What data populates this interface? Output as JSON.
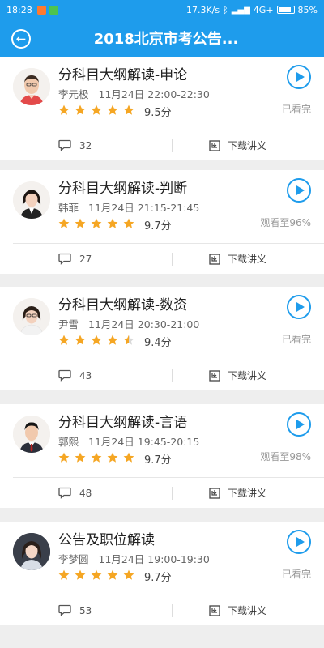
{
  "status_bar": {
    "time": "18:28",
    "network_speed": "17.3K/s",
    "network_type": "4G+",
    "battery": "85%",
    "battery_level": 0.85
  },
  "app_bar": {
    "title": "2018北京市考公告..."
  },
  "courses": [
    {
      "title": "分科目大纲解读-申论",
      "teacher": "李元极",
      "time": "11月24日 22:00-22:30",
      "rating": 5,
      "score": "9.5分",
      "progress": "已看完",
      "comments": "32",
      "download_label": "下载讲义"
    },
    {
      "title": "分科目大纲解读-判断",
      "teacher": "韩菲",
      "time": "11月24日 21:15-21:45",
      "rating": 5,
      "score": "9.7分",
      "progress": "观看至96%",
      "comments": "27",
      "download_label": "下载讲义"
    },
    {
      "title": "分科目大纲解读-数资",
      "teacher": "尹雪",
      "time": "11月24日 20:30-21:00",
      "rating": 4.5,
      "score": "9.4分",
      "progress": "已看完",
      "comments": "43",
      "download_label": "下载讲义"
    },
    {
      "title": "分科目大纲解读-言语",
      "teacher": "郭熙",
      "time": "11月24日 19:45-20:15",
      "rating": 5,
      "score": "9.7分",
      "progress": "观看至98%",
      "comments": "48",
      "download_label": "下载讲义"
    },
    {
      "title": "公告及职位解读",
      "teacher": "李梦圆",
      "time": "11月24日 19:00-19:30",
      "rating": 5,
      "score": "9.7分",
      "progress": "已看完",
      "comments": "53",
      "download_label": "下载讲义"
    }
  ],
  "colors": {
    "accent": "#1e9cec",
    "star": "#f5a623",
    "background": "#eeeeee"
  }
}
